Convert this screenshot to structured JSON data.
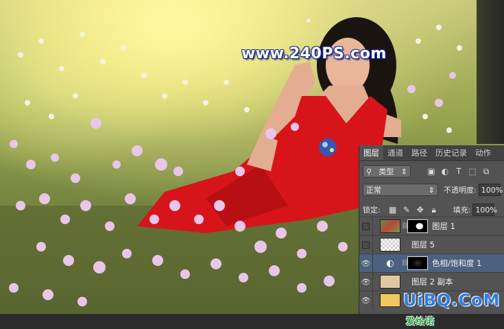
{
  "watermark": "www.240PS.com",
  "panel": {
    "tabs": [
      "图层",
      "通道",
      "路径",
      "历史记录",
      "动作"
    ],
    "filter_label": "类型",
    "blend_mode": "正常",
    "opacity_label": "不透明度:",
    "opacity_value": "100%",
    "lock_label": "锁定:",
    "fill_label": "填充:",
    "fill_value": "100%",
    "layers": [
      {
        "name": "图层 1",
        "visible": false
      },
      {
        "name": "图层 5",
        "visible": false
      },
      {
        "name": "色相/饱和度 1",
        "visible": true
      },
      {
        "name": "图层 2 副本",
        "visible": true
      },
      {
        "name": "",
        "visible": true
      }
    ]
  },
  "site_logo": {
    "text": "UiBQ.CoM",
    "sub": "爱绘诺"
  },
  "colors": {
    "panel_bg": "#535353",
    "selected_row": "#4b617f",
    "dress_red": "#d8141b"
  }
}
